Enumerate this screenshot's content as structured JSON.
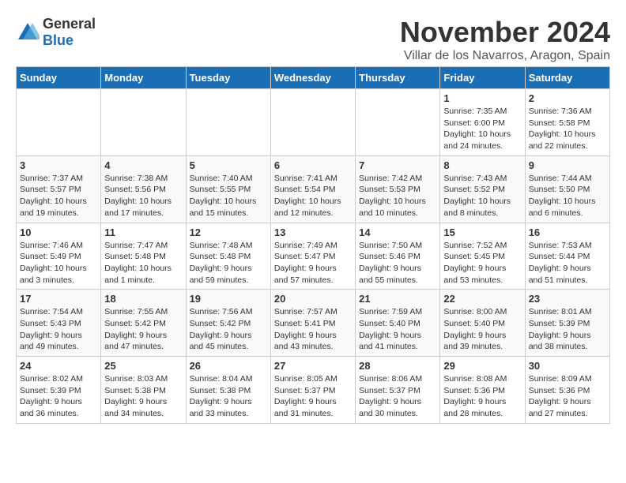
{
  "logo": {
    "text_general": "General",
    "text_blue": "Blue"
  },
  "title": "November 2024",
  "subtitle": "Villar de los Navarros, Aragon, Spain",
  "weekdays": [
    "Sunday",
    "Monday",
    "Tuesday",
    "Wednesday",
    "Thursday",
    "Friday",
    "Saturday"
  ],
  "weeks": [
    [
      {
        "day": "",
        "info": ""
      },
      {
        "day": "",
        "info": ""
      },
      {
        "day": "",
        "info": ""
      },
      {
        "day": "",
        "info": ""
      },
      {
        "day": "",
        "info": ""
      },
      {
        "day": "1",
        "info": "Sunrise: 7:35 AM\nSunset: 6:00 PM\nDaylight: 10 hours\nand 24 minutes."
      },
      {
        "day": "2",
        "info": "Sunrise: 7:36 AM\nSunset: 5:58 PM\nDaylight: 10 hours\nand 22 minutes."
      }
    ],
    [
      {
        "day": "3",
        "info": "Sunrise: 7:37 AM\nSunset: 5:57 PM\nDaylight: 10 hours\nand 19 minutes."
      },
      {
        "day": "4",
        "info": "Sunrise: 7:38 AM\nSunset: 5:56 PM\nDaylight: 10 hours\nand 17 minutes."
      },
      {
        "day": "5",
        "info": "Sunrise: 7:40 AM\nSunset: 5:55 PM\nDaylight: 10 hours\nand 15 minutes."
      },
      {
        "day": "6",
        "info": "Sunrise: 7:41 AM\nSunset: 5:54 PM\nDaylight: 10 hours\nand 12 minutes."
      },
      {
        "day": "7",
        "info": "Sunrise: 7:42 AM\nSunset: 5:53 PM\nDaylight: 10 hours\nand 10 minutes."
      },
      {
        "day": "8",
        "info": "Sunrise: 7:43 AM\nSunset: 5:52 PM\nDaylight: 10 hours\nand 8 minutes."
      },
      {
        "day": "9",
        "info": "Sunrise: 7:44 AM\nSunset: 5:50 PM\nDaylight: 10 hours\nand 6 minutes."
      }
    ],
    [
      {
        "day": "10",
        "info": "Sunrise: 7:46 AM\nSunset: 5:49 PM\nDaylight: 10 hours\nand 3 minutes."
      },
      {
        "day": "11",
        "info": "Sunrise: 7:47 AM\nSunset: 5:48 PM\nDaylight: 10 hours\nand 1 minute."
      },
      {
        "day": "12",
        "info": "Sunrise: 7:48 AM\nSunset: 5:48 PM\nDaylight: 9 hours\nand 59 minutes."
      },
      {
        "day": "13",
        "info": "Sunrise: 7:49 AM\nSunset: 5:47 PM\nDaylight: 9 hours\nand 57 minutes."
      },
      {
        "day": "14",
        "info": "Sunrise: 7:50 AM\nSunset: 5:46 PM\nDaylight: 9 hours\nand 55 minutes."
      },
      {
        "day": "15",
        "info": "Sunrise: 7:52 AM\nSunset: 5:45 PM\nDaylight: 9 hours\nand 53 minutes."
      },
      {
        "day": "16",
        "info": "Sunrise: 7:53 AM\nSunset: 5:44 PM\nDaylight: 9 hours\nand 51 minutes."
      }
    ],
    [
      {
        "day": "17",
        "info": "Sunrise: 7:54 AM\nSunset: 5:43 PM\nDaylight: 9 hours\nand 49 minutes."
      },
      {
        "day": "18",
        "info": "Sunrise: 7:55 AM\nSunset: 5:42 PM\nDaylight: 9 hours\nand 47 minutes."
      },
      {
        "day": "19",
        "info": "Sunrise: 7:56 AM\nSunset: 5:42 PM\nDaylight: 9 hours\nand 45 minutes."
      },
      {
        "day": "20",
        "info": "Sunrise: 7:57 AM\nSunset: 5:41 PM\nDaylight: 9 hours\nand 43 minutes."
      },
      {
        "day": "21",
        "info": "Sunrise: 7:59 AM\nSunset: 5:40 PM\nDaylight: 9 hours\nand 41 minutes."
      },
      {
        "day": "22",
        "info": "Sunrise: 8:00 AM\nSunset: 5:40 PM\nDaylight: 9 hours\nand 39 minutes."
      },
      {
        "day": "23",
        "info": "Sunrise: 8:01 AM\nSunset: 5:39 PM\nDaylight: 9 hours\nand 38 minutes."
      }
    ],
    [
      {
        "day": "24",
        "info": "Sunrise: 8:02 AM\nSunset: 5:39 PM\nDaylight: 9 hours\nand 36 minutes."
      },
      {
        "day": "25",
        "info": "Sunrise: 8:03 AM\nSunset: 5:38 PM\nDaylight: 9 hours\nand 34 minutes."
      },
      {
        "day": "26",
        "info": "Sunrise: 8:04 AM\nSunset: 5:38 PM\nDaylight: 9 hours\nand 33 minutes."
      },
      {
        "day": "27",
        "info": "Sunrise: 8:05 AM\nSunset: 5:37 PM\nDaylight: 9 hours\nand 31 minutes."
      },
      {
        "day": "28",
        "info": "Sunrise: 8:06 AM\nSunset: 5:37 PM\nDaylight: 9 hours\nand 30 minutes."
      },
      {
        "day": "29",
        "info": "Sunrise: 8:08 AM\nSunset: 5:36 PM\nDaylight: 9 hours\nand 28 minutes."
      },
      {
        "day": "30",
        "info": "Sunrise: 8:09 AM\nSunset: 5:36 PM\nDaylight: 9 hours\nand 27 minutes."
      }
    ]
  ]
}
